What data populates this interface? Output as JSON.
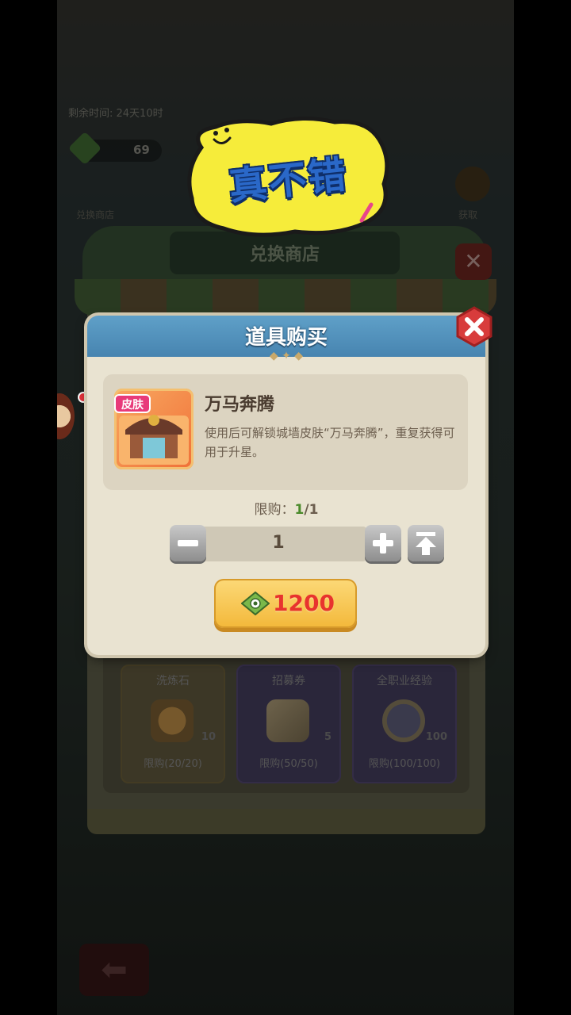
{
  "background": {
    "timer_text": "剩余时间: 24天10时",
    "gem_count": "69",
    "left_button_label": "兑换商店",
    "right_button_label": "获取"
  },
  "shop": {
    "title": "兑换商店",
    "items": [
      {
        "name": "洗炼石",
        "count": "10",
        "limit": "限购(20/20)",
        "color": "#6e6446"
      },
      {
        "name": "招募券",
        "count": "5",
        "limit": "限购(50/50)",
        "color": "#4e466a"
      },
      {
        "name": "全职业经验",
        "count": "100",
        "limit": "限购(100/100)",
        "color": "#4e466a"
      }
    ]
  },
  "modal": {
    "title": "道具购买",
    "item": {
      "badge": "皮肤",
      "name": "万马奔腾",
      "description": "使用后可解锁城墙皮肤“万马奔腾”，重复获得可用于升星。"
    },
    "limit_label": "限购：",
    "limit_current": "1",
    "limit_sep_total": "/1",
    "quantity": "1",
    "price": "1200",
    "buy_button_color": "#f3b83a",
    "price_color": "#e8332e"
  },
  "sticker": {
    "text": "真不错",
    "bg_color": "#f6ec3a"
  },
  "icons": {
    "close": "close-icon",
    "minus": "minus-icon",
    "plus": "plus-icon",
    "max": "max-icon",
    "ticket": "ticket-icon",
    "back": "back-arrow-icon"
  }
}
